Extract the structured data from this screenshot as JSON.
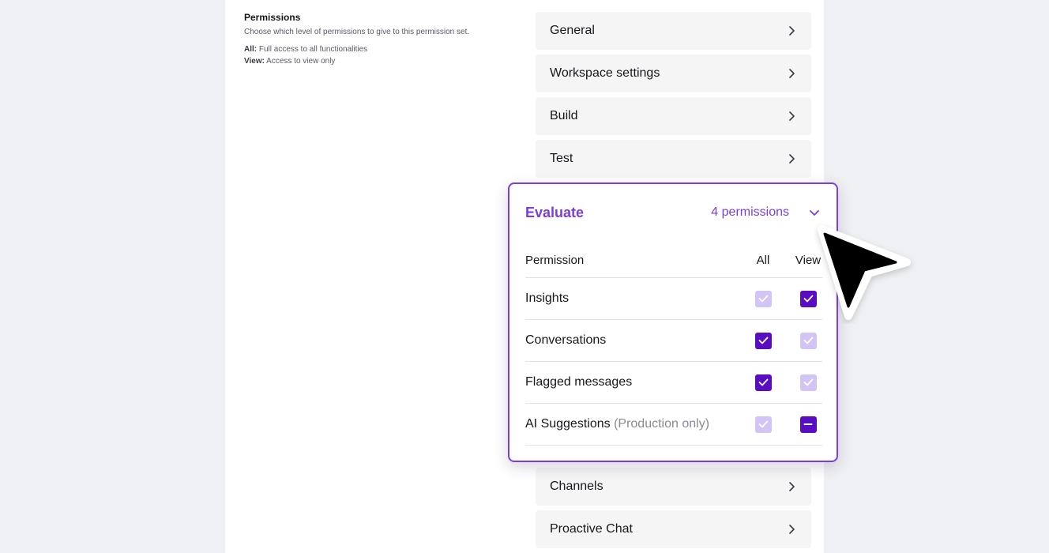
{
  "info": {
    "title": "Permissions",
    "description": "Choose which level of permissions to give to this permission set.",
    "all_key": "All:",
    "all_text": " Full access to all functionalities",
    "view_key": "View:",
    "view_text": " Access to view only"
  },
  "sections_top": [
    {
      "label": "General"
    },
    {
      "label": "Workspace settings"
    },
    {
      "label": "Build"
    },
    {
      "label": "Test"
    }
  ],
  "evaluate": {
    "title": "Evaluate",
    "count": "4 permissions",
    "headers": {
      "permission": "Permission",
      "all": "All",
      "view": "View"
    },
    "rows": [
      {
        "name": "Insights",
        "note": "",
        "all": "checked-muted",
        "view": "checked"
      },
      {
        "name": "Conversations",
        "note": "",
        "all": "checked",
        "view": "checked-muted"
      },
      {
        "name": "Flagged messages",
        "note": "",
        "all": "checked",
        "view": "checked-muted"
      },
      {
        "name": "AI Suggestions",
        "note": "(Production only)",
        "all": "checked-muted",
        "view": "indeterminate"
      }
    ]
  },
  "sections_bottom": [
    {
      "label": "Channels"
    },
    {
      "label": "Proactive Chat"
    }
  ],
  "colors": {
    "accent": "#7b3fd8",
    "checkbox_on": "#5a0cc1",
    "checkbox_muted": "#d2c5f6"
  },
  "icons": {
    "section_chevron": "chevron-right-icon",
    "card_chevron": "chevron-down-icon",
    "pointer": "mouse-pointer-icon"
  }
}
